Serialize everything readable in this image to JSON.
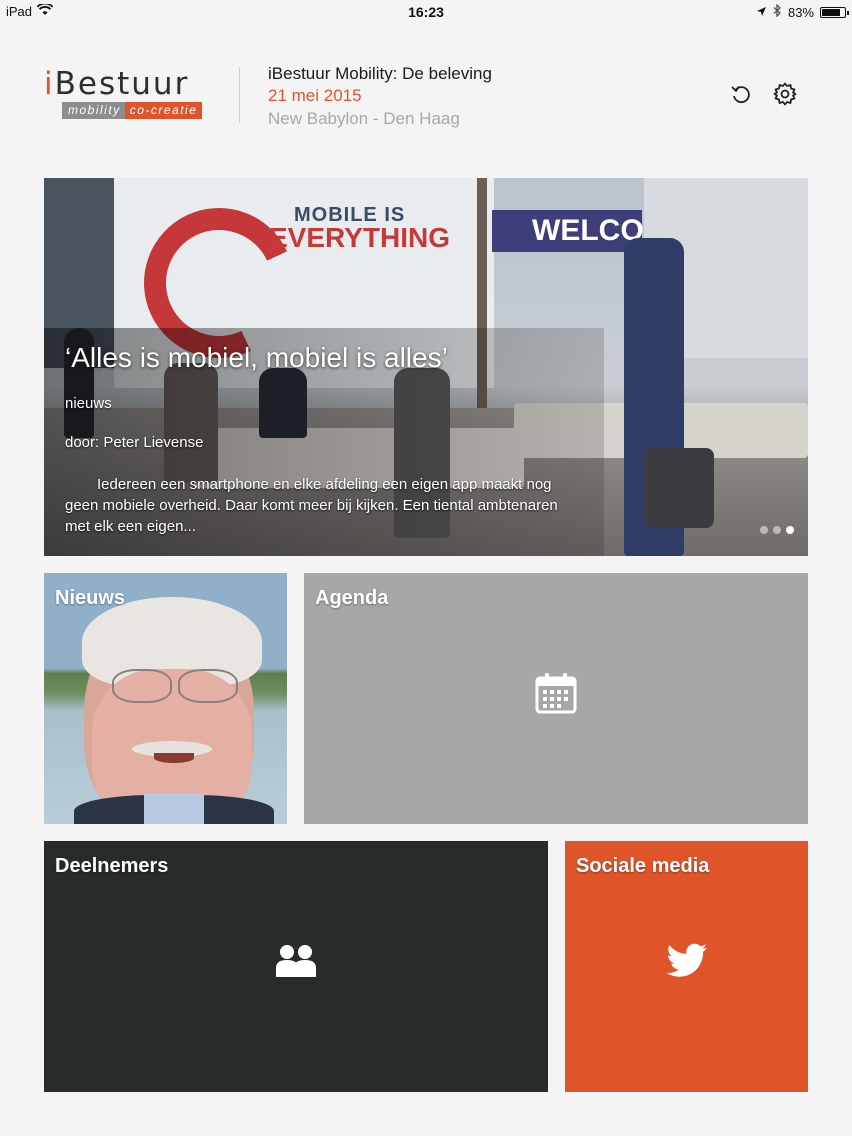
{
  "status_bar": {
    "device": "iPad",
    "time": "16:23",
    "battery": "83%",
    "battery_level": 0.83
  },
  "header": {
    "logo": {
      "word": "Bestuur",
      "word_prefix": "i",
      "tag_left": "mobility",
      "tag_right": "co-creatie"
    },
    "event_title": "iBestuur Mobility: De beleving",
    "event_date": "21 mei 2015",
    "event_location": "New Babylon - Den Haag",
    "icons": [
      "refresh-icon",
      "settings-gear-icon"
    ]
  },
  "hero": {
    "title": "‘Alles is mobiel, mobiel is alles’",
    "category": "nieuws",
    "author": "door: Peter Lievense",
    "excerpt": "Iedereen een smartphone en elke afdeling een eigen app maakt nog geen mobiele overheid. Daar komt meer bij kijken. Een tiental ambtenaren met elk een eigen...",
    "photo_signage": {
      "line1": "MOBILE IS",
      "line2": "EVERYTHING",
      "welcome": "WELCOM"
    },
    "page_count": 3,
    "active_page": 3
  },
  "tiles": {
    "nieuws": {
      "label": "Nieuws"
    },
    "agenda": {
      "label": "Agenda",
      "icon": "calendar-icon"
    },
    "deelnemers": {
      "label": "Deelnemers",
      "icon": "people-icon"
    },
    "sociale_media": {
      "label": "Sociale media",
      "icon": "twitter-bird-icon"
    }
  },
  "colors": {
    "accent": "#e0542a",
    "agenda_tile": "#a7a7a7",
    "deelnemers_tile": "#272b29",
    "background": "#f4f4f4"
  }
}
